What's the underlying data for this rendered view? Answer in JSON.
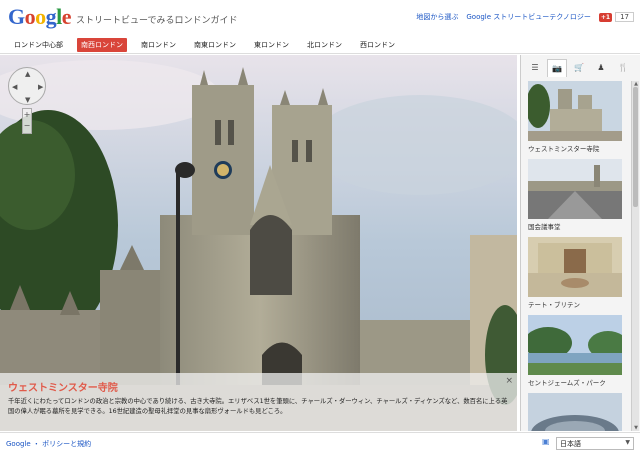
{
  "header": {
    "logo": [
      "G",
      "o",
      "o",
      "g",
      "l",
      "e"
    ],
    "logo_colors": [
      "#3366cc",
      "#d6422f",
      "#f4b400",
      "#3366cc",
      "#2a9a43",
      "#d6422f"
    ],
    "site_title": "ストリートビューでみるロンドンガイド",
    "links": [
      "地図から選ぶ",
      "Google ストリートビューテクノロジー"
    ],
    "gplus_label": "+1",
    "gplus_count": "17"
  },
  "nav": {
    "items": [
      "ロンドン中心部",
      "南西ロンドン",
      "南ロンドン",
      "南東ロンドン",
      "東ロンドン",
      "北ロンドン",
      "西ロンドン"
    ],
    "active_index": 1
  },
  "streetview": {
    "caption_title": "ウェストミンスター寺院",
    "caption_text": "千年近くにわたってロンドンの政治と宗教の中心であり続ける、古き大寺院。エリザベス1世を筆頭に、チャールズ・ダーウィン、チャールズ・ディケンズなど、数百名に上る英国の偉人が眠る墓所を見学できる。16世紀建造の聖母礼拝堂の見事な扇形ヴォールドも見どころ。",
    "close": "×"
  },
  "panel": {
    "tabs": [
      "☰",
      "📷",
      "🛒",
      "♟",
      "🍴"
    ],
    "thumbs": [
      {
        "label": "ウェストミンスター寺院"
      },
      {
        "label": "国会議事堂"
      },
      {
        "label": "テート・ブリテン"
      },
      {
        "label": "セントジェームズ・パーク"
      },
      {
        "label": ""
      }
    ]
  },
  "footer": {
    "link": "Google ・ ポリシーと規約",
    "language": "日本語"
  },
  "colors": {
    "accent_red": "#d9453a",
    "link_blue": "#1a55c4"
  }
}
